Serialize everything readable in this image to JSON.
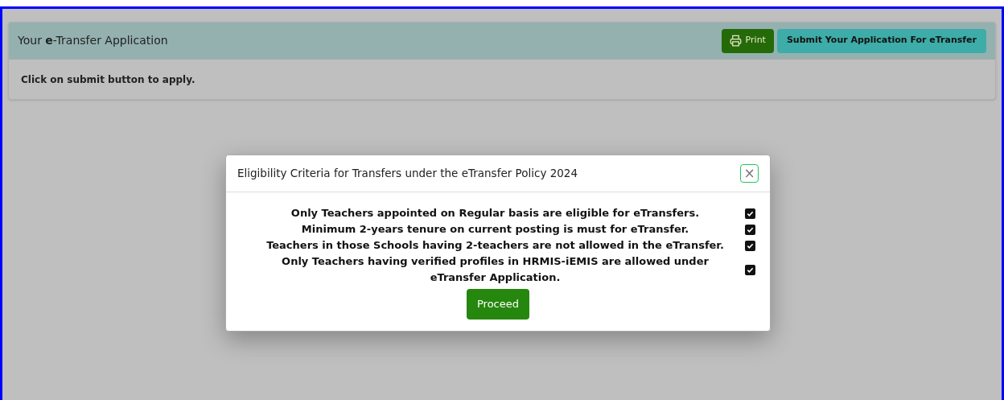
{
  "card": {
    "title": "Your **e**-Transfer Application",
    "print_button": "Print",
    "submit_button": "Submit Your Application For **eTransfer**",
    "body": "Click on submit button to apply."
  },
  "modal": {
    "title": "Eligibility Criteria for Transfers under the eTransfer Policy 2024",
    "close": "×",
    "criteria": [
      {
        "text": "Only Teachers appointed on Regular basis are eligible for eTransfers.",
        "checked": true
      },
      {
        "text": "Minimum 2-years tenure on current posting is must for eTransfer.",
        "checked": true
      },
      {
        "text": "Teachers in those Schools having 2-teachers are not allowed in the eTransfer.",
        "checked": true
      },
      {
        "text": "Only Teachers having verified profiles in HRMIS-iEMIS are allowed under eTransfer Application.",
        "checked": true
      }
    ],
    "proceed_button": "Proceed"
  }
}
